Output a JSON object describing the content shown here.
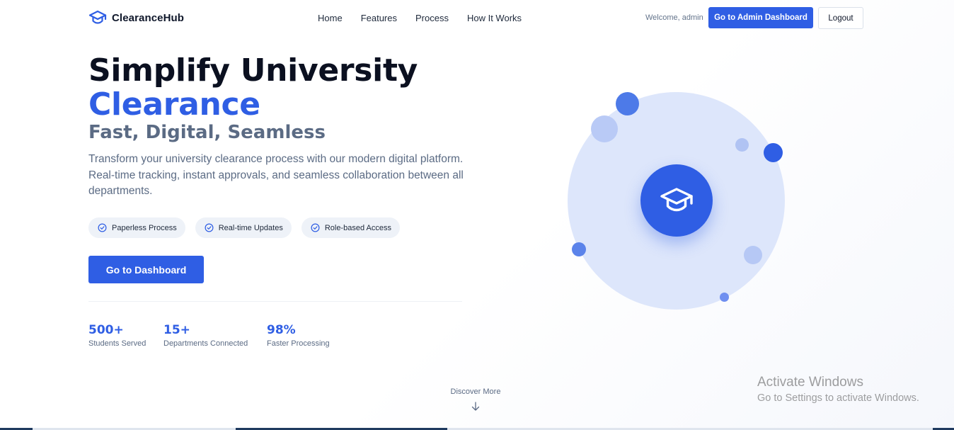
{
  "navbar": {
    "brand": "ClearanceHub",
    "links": [
      "Home",
      "Features",
      "Process",
      "How It Works"
    ],
    "welcome": "Welcome, admin",
    "admin_button": "Go to Admin Dashboard",
    "logout_button": "Logout"
  },
  "hero": {
    "title_line1": "Simplify University",
    "title_line2": "Clearance",
    "subtitle": "Fast, Digital, Seamless",
    "description": "Transform your university clearance process with our modern digital platform. Real-time tracking, instant approvals, and seamless collaboration between all departments.",
    "features": [
      "Paperless Process",
      "Real-time Updates",
      "Role-based Access"
    ],
    "cta_button": "Go to Dashboard",
    "stats": [
      {
        "value": "500+",
        "label": "Students Served"
      },
      {
        "value": "15+",
        "label": "Departments Connected"
      },
      {
        "value": "98%",
        "label": "Faster Processing"
      }
    ]
  },
  "illustration": {
    "center_icon": "graduation-cap-icon"
  },
  "discover": {
    "label": "Discover More",
    "icon": "arrow-down-icon"
  },
  "watermark": {
    "title": "Activate Windows",
    "subtitle": "Go to Settings to activate Windows."
  },
  "colors": {
    "accent": "#2f5ee4",
    "text_dark": "#0b1020",
    "text_muted": "#5b6b84",
    "pill_bg": "#eef2f8",
    "orb_bg": "#dde6fb"
  }
}
